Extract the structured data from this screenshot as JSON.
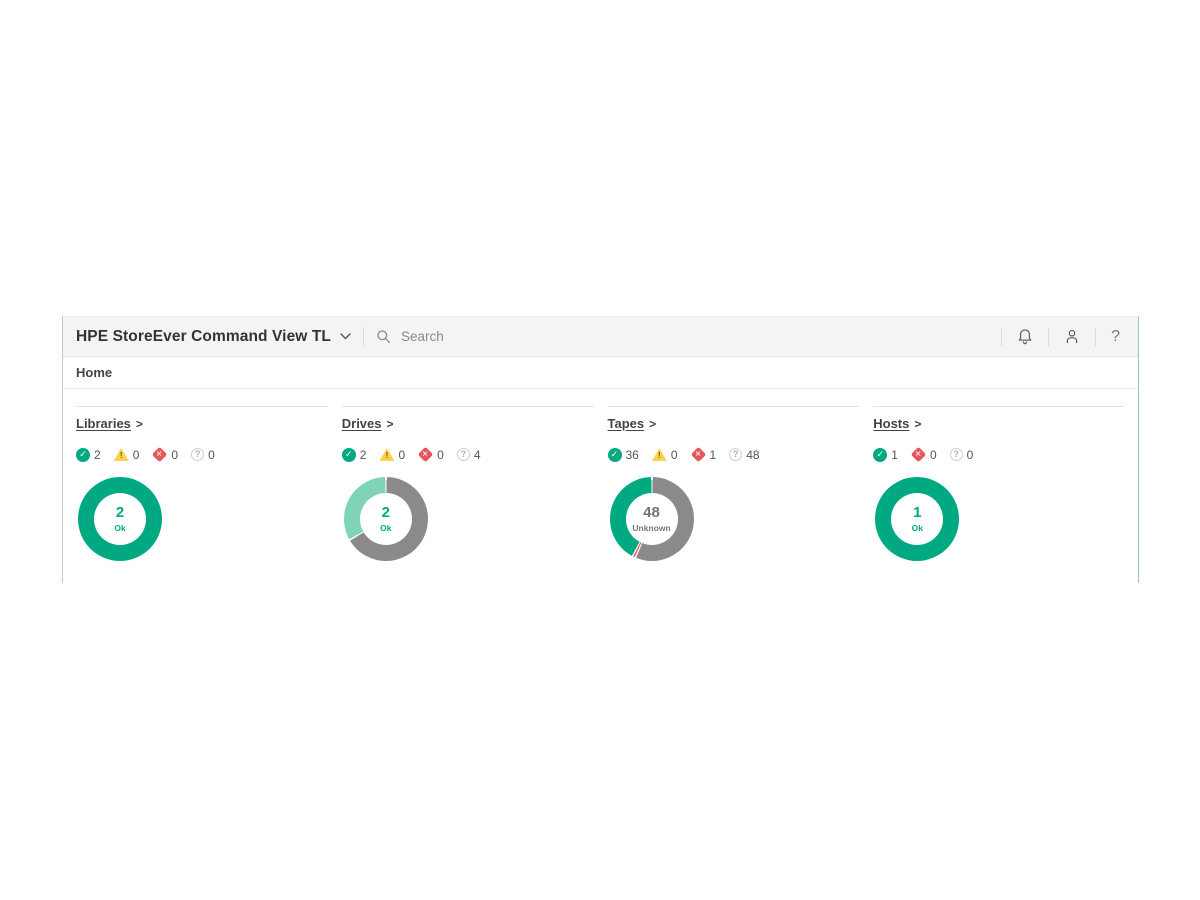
{
  "app": {
    "title": "HPE StoreEver Command View TL",
    "search": {
      "placeholder": "Search"
    },
    "help_label": "?"
  },
  "breadcrumb": {
    "label": "Home"
  },
  "colors": {
    "brand_green": "#01a982",
    "ok_light_teal": "#7fd3b8",
    "unknown_gray": "#8a8a8a",
    "critical_red": "#e4585c",
    "warning_yellow": "#ffd24d",
    "topbar_bg": "#f4f4f4"
  },
  "panels": [
    {
      "title": "Libraries",
      "chevron": ">",
      "statuses": [
        {
          "icon": "ok",
          "count": "2"
        },
        {
          "icon": "warning",
          "count": "0"
        },
        {
          "icon": "critical",
          "count": "0"
        },
        {
          "icon": "unknown",
          "count": "0"
        }
      ]
    },
    {
      "title": "Drives",
      "chevron": ">",
      "statuses": [
        {
          "icon": "ok",
          "count": "2"
        },
        {
          "icon": "warning",
          "count": "0"
        },
        {
          "icon": "critical",
          "count": "0"
        },
        {
          "icon": "unknown",
          "count": "4"
        }
      ]
    },
    {
      "title": "Tapes",
      "chevron": ">",
      "statuses": [
        {
          "icon": "ok",
          "count": "36"
        },
        {
          "icon": "warning",
          "count": "0"
        },
        {
          "icon": "critical",
          "count": "1"
        },
        {
          "icon": "unknown",
          "count": "48"
        }
      ]
    },
    {
      "title": "Hosts",
      "chevron": ">",
      "statuses": [
        {
          "icon": "ok",
          "count": "1"
        },
        {
          "icon": "critical",
          "count": "0"
        },
        {
          "icon": "unknown",
          "count": "0"
        }
      ]
    }
  ],
  "chart_data": [
    {
      "type": "pie",
      "title": "Libraries",
      "direction": "counterclockwise",
      "segments": [
        {
          "label": "Ok",
          "value": 2,
          "color": "#01a982"
        }
      ],
      "center": {
        "value": "2",
        "label": "Ok",
        "color": "#01a982"
      }
    },
    {
      "type": "pie",
      "title": "Drives",
      "direction": "counterclockwise",
      "segments": [
        {
          "label": "Ok",
          "value": 2,
          "color": "#7fd3b8"
        },
        {
          "label": "Unknown",
          "value": 4,
          "color": "#8a8a8a"
        }
      ],
      "center": {
        "value": "2",
        "label": "Ok",
        "color": "#01a982"
      }
    },
    {
      "type": "pie",
      "title": "Tapes",
      "direction": "counterclockwise",
      "segments": [
        {
          "label": "Ok",
          "value": 36,
          "color": "#01a982"
        },
        {
          "label": "Critical",
          "value": 1,
          "color": "#e4585c"
        },
        {
          "label": "Unknown",
          "value": 48,
          "color": "#8a8a8a"
        }
      ],
      "center": {
        "value": "48",
        "label": "Unknown",
        "color": "#757575"
      }
    },
    {
      "type": "pie",
      "title": "Hosts",
      "direction": "counterclockwise",
      "segments": [
        {
          "label": "Ok",
          "value": 1,
          "color": "#01a982"
        }
      ],
      "center": {
        "value": "1",
        "label": "Ok",
        "color": "#01a982"
      }
    }
  ]
}
